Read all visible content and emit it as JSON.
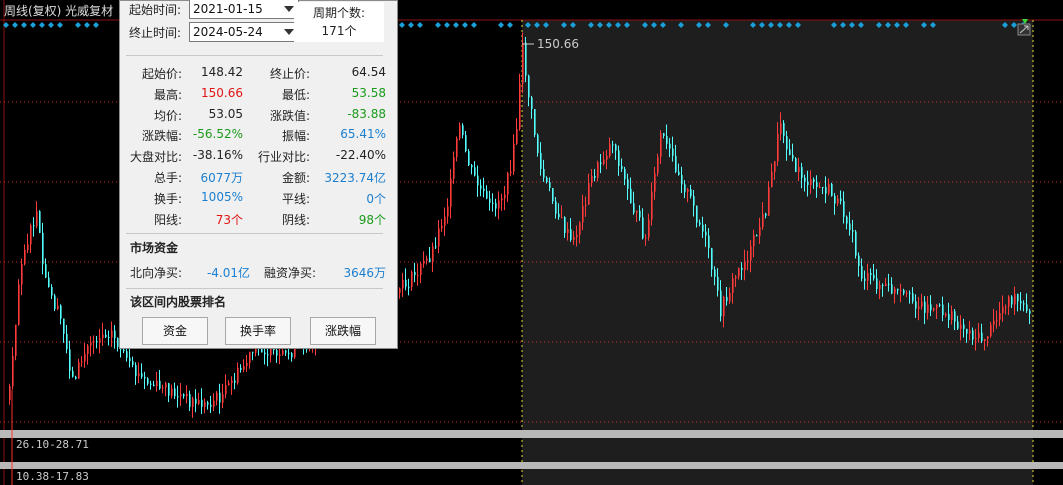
{
  "chart": {
    "title": "周线(复权)  光威复材",
    "high_label": "150.66",
    "range_label_1": "26.10-28.71",
    "range_label_2": "10.38-17.83",
    "colors": {
      "up": "#ff3b3b",
      "down": "#54ffff",
      "dash": "#ff3030",
      "selection": "#e8e030",
      "marker": "#1aa0d8"
    }
  },
  "panel": {
    "start_label": "起始时间:",
    "start_value": "2021-01-15",
    "end_label": "终止时间:",
    "end_value": "2024-05-24",
    "period_label": "周期个数:",
    "period_value": "171个",
    "stats": [
      {
        "k1": "起始价:",
        "v1": "148.42",
        "c1": "black",
        "k2": "终止价:",
        "v2": "64.54",
        "c2": "black"
      },
      {
        "k1": "最高:",
        "v1": "150.66",
        "c1": "red",
        "k2": "最低:",
        "v2": "53.58",
        "c2": "green"
      },
      {
        "k1": "均价:",
        "v1": "53.05",
        "c1": "black",
        "k2": "涨跌值:",
        "v2": "-83.88",
        "c2": "green"
      },
      {
        "k1": "涨跌幅:",
        "v1": "-56.52%",
        "c1": "green",
        "k2": "振幅:",
        "v2": "65.41%",
        "c2": "blue"
      },
      {
        "k1": "大盘对比:",
        "v1": "-38.16%",
        "c1": "black",
        "k2": "行业对比:",
        "v2": "-22.40%",
        "c2": "black"
      },
      {
        "k1": "总手:",
        "v1": "6077万",
        "c1": "blue",
        "k2": "金额:",
        "v2": "3223.74亿",
        "c2": "blue"
      },
      {
        "k1": "换手:",
        "v1": "1005%",
        "c1": "blue",
        "k2": "平线:",
        "v2": "0个",
        "c2": "blue"
      },
      {
        "k1": "阳线:",
        "v1": "73个",
        "c1": "red",
        "k2": "阴线:",
        "v2": "98个",
        "c2": "green"
      }
    ],
    "market_fund_title": "市场资金",
    "north_label": "北向净买:",
    "north_value": "-4.01亿",
    "margin_label": "融资净买:",
    "margin_value": "3646万",
    "ranking_title": "该区间内股票排名",
    "buttons": [
      "资金",
      "换手率",
      "涨跌幅"
    ]
  }
}
